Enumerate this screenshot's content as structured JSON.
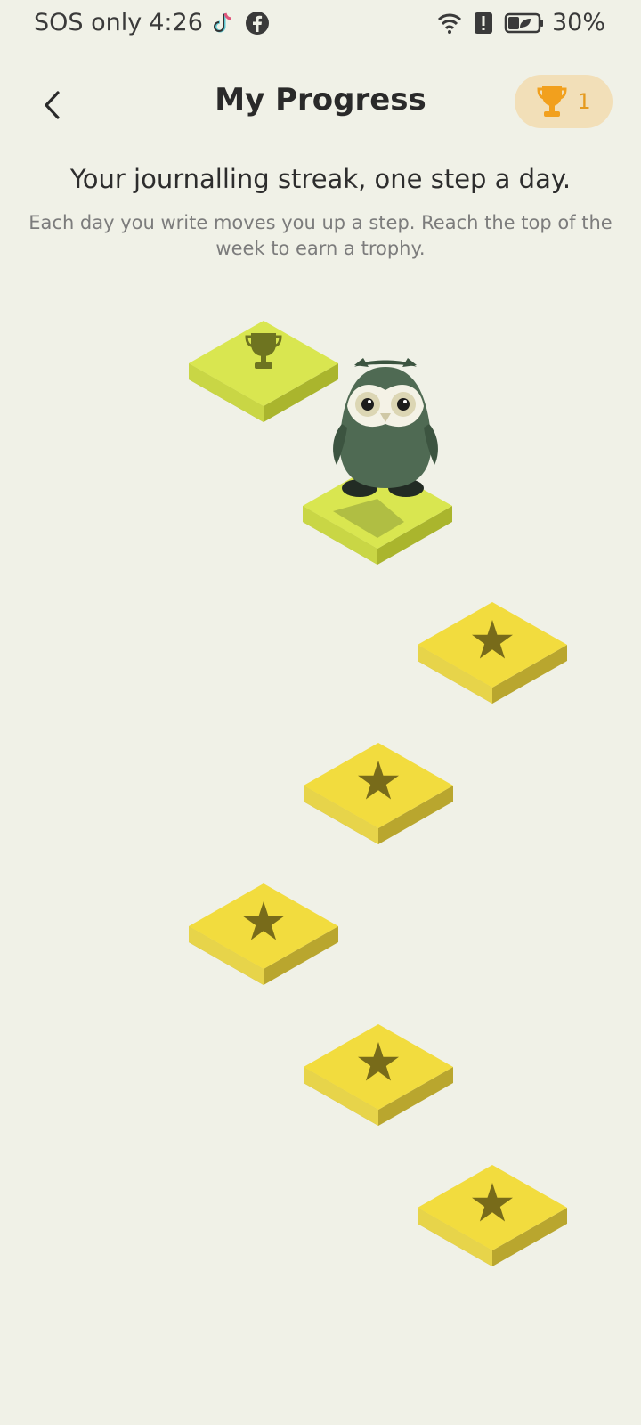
{
  "status_bar": {
    "carrier": "SOS only",
    "time": "4:26",
    "battery": "30%",
    "icons": [
      "tiktok-icon",
      "facebook-icon",
      "wifi-icon",
      "alert-icon",
      "battery-saver-icon"
    ]
  },
  "header": {
    "title": "My Progress",
    "trophy_count": "1"
  },
  "intro": {
    "subtitle": "Your journalling streak, one step a day.",
    "description": "Each day you write moves you up a step. Reach the top of the week to earn a trophy."
  },
  "steps": [
    {
      "icon": "star-icon",
      "state": "pending"
    },
    {
      "icon": "star-icon",
      "state": "pending"
    },
    {
      "icon": "star-icon",
      "state": "pending"
    },
    {
      "icon": "star-icon",
      "state": "pending"
    },
    {
      "icon": "star-icon",
      "state": "pending"
    },
    {
      "icon": "owl-current",
      "state": "current"
    },
    {
      "icon": "trophy-icon",
      "state": "goal"
    }
  ],
  "colors": {
    "background": "#f0f1e7",
    "tile_yellow": "#f2dc3e",
    "tile_lime": "#d9e650",
    "accent_orange": "#f2a01d",
    "badge_bg": "#f2dfb8"
  }
}
